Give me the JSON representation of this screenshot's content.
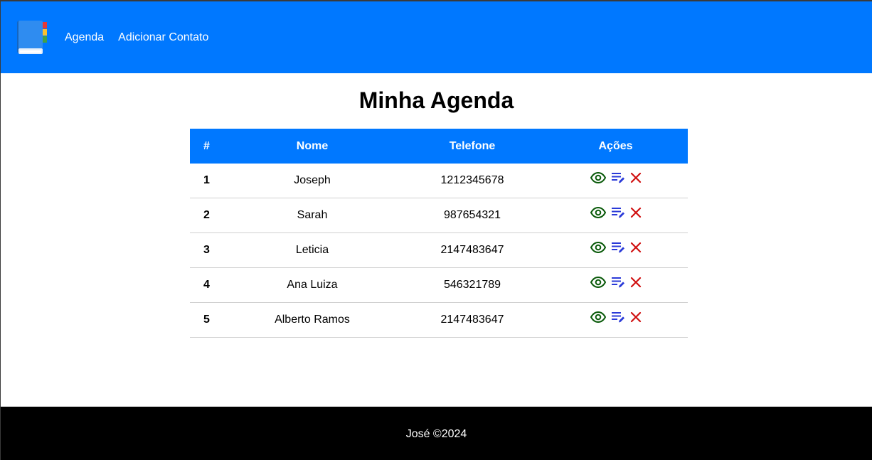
{
  "colors": {
    "primary": "#0078ff",
    "view": "#0a5a0a",
    "edit": "#2a3ad8",
    "delete": "#d01010",
    "footer_bg": "#000000"
  },
  "nav": {
    "logo_icon": "address-book-icon",
    "links": [
      {
        "label": "Agenda"
      },
      {
        "label": "Adicionar Contato"
      }
    ]
  },
  "main": {
    "title": "Minha Agenda",
    "table": {
      "headers": [
        "#",
        "Nome",
        "Telefone",
        "Ações"
      ],
      "rows": [
        {
          "id": "1",
          "nome": "Joseph",
          "telefone": "1212345678"
        },
        {
          "id": "2",
          "nome": "Sarah",
          "telefone": "987654321"
        },
        {
          "id": "3",
          "nome": "Leticia",
          "telefone": "2147483647"
        },
        {
          "id": "4",
          "nome": "Ana Luiza",
          "telefone": "546321789"
        },
        {
          "id": "5",
          "nome": "Alberto Ramos",
          "telefone": "2147483647"
        }
      ],
      "action_icons": [
        "eye-icon",
        "edit-list-icon",
        "close-icon"
      ]
    }
  },
  "footer": {
    "text": "José ©2024"
  }
}
